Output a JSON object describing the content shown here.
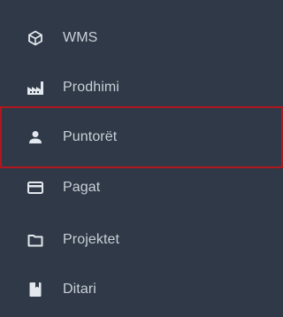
{
  "sidebar": {
    "items": [
      {
        "label": "WMS",
        "icon": "cube-outline-icon"
      },
      {
        "label": "Prodhimi",
        "icon": "factory-icon"
      },
      {
        "label": "Puntorët",
        "icon": "person-icon",
        "active": true
      },
      {
        "label": "Pagat",
        "icon": "credit-card-icon"
      },
      {
        "label": "Projektet",
        "icon": "folder-icon"
      },
      {
        "label": "Ditari",
        "icon": "book-icon"
      }
    ],
    "colors": {
      "background": "#2f3947",
      "text": "#c9d0d8",
      "icon": "#e3e8ee",
      "active_border": "#b0161e"
    }
  }
}
